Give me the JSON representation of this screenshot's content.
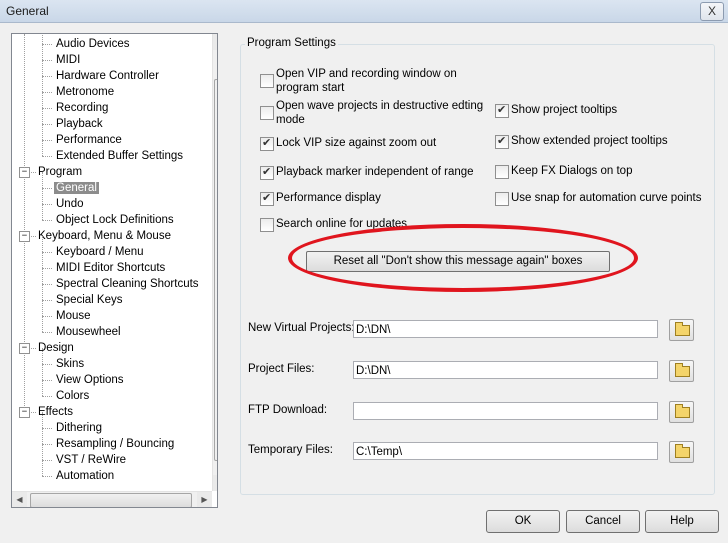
{
  "window": {
    "title": "General",
    "close_glyph": "X"
  },
  "tree": {
    "items": [
      {
        "label": "Audio Devices"
      },
      {
        "label": "MIDI"
      },
      {
        "label": "Hardware Controller"
      },
      {
        "label": "Metronome"
      },
      {
        "label": "Recording"
      },
      {
        "label": "Playback"
      },
      {
        "label": "Performance"
      },
      {
        "label": "Extended Buffer Settings"
      },
      {
        "label": "Program"
      },
      {
        "label": "General",
        "selected": true
      },
      {
        "label": "Undo"
      },
      {
        "label": "Object Lock Definitions"
      },
      {
        "label": "Keyboard, Menu & Mouse"
      },
      {
        "label": "Keyboard / Menu"
      },
      {
        "label": "MIDI Editor Shortcuts"
      },
      {
        "label": "Spectral Cleaning Shortcuts"
      },
      {
        "label": "Special Keys"
      },
      {
        "label": "Mouse"
      },
      {
        "label": "Mousewheel"
      },
      {
        "label": "Design"
      },
      {
        "label": "Skins"
      },
      {
        "label": "View Options"
      },
      {
        "label": "Colors"
      },
      {
        "label": "Effects"
      },
      {
        "label": "Dithering"
      },
      {
        "label": "Resampling / Bouncing"
      },
      {
        "label": "VST / ReWire"
      },
      {
        "label": "Automation"
      }
    ],
    "expander_glyph": "−",
    "scroll_up": "▲",
    "scroll_down": "▼",
    "scroll_left": "◀",
    "scroll_right": "▶"
  },
  "program_settings": {
    "group_label": "Program Settings",
    "left_options": [
      {
        "label": "Open VIP and recording window on\nprogram start",
        "checked": false
      },
      {
        "label": "Open wave projects in destructive edting\nmode",
        "checked": false
      },
      {
        "label": "Lock VIP size against zoom out",
        "checked": true
      },
      {
        "label": "Playback marker independent of range",
        "checked": true
      },
      {
        "label": "Performance display",
        "checked": true
      },
      {
        "label": "Search online for updates",
        "checked": false
      }
    ],
    "right_options": [
      {
        "label": "Show project tooltips",
        "checked": true
      },
      {
        "label": "Show extended project tooltips",
        "checked": true
      },
      {
        "label": "Keep FX Dialogs on top",
        "checked": false
      },
      {
        "label": "Use snap for automation curve points",
        "checked": false
      }
    ],
    "reset_button": "Reset all \"Don't show this message again\" boxes",
    "highlight_color": "#e0151e"
  },
  "paths": [
    {
      "label": "New Virtual Projects:",
      "value": "D:\\DN\\"
    },
    {
      "label": "Project Files:",
      "value": "D:\\DN\\"
    },
    {
      "label": "FTP Download:",
      "value": ""
    },
    {
      "label": "Temporary Files:",
      "value": "C:\\Temp\\"
    }
  ],
  "buttons": {
    "ok": "OK",
    "cancel": "Cancel",
    "help": "Help"
  }
}
